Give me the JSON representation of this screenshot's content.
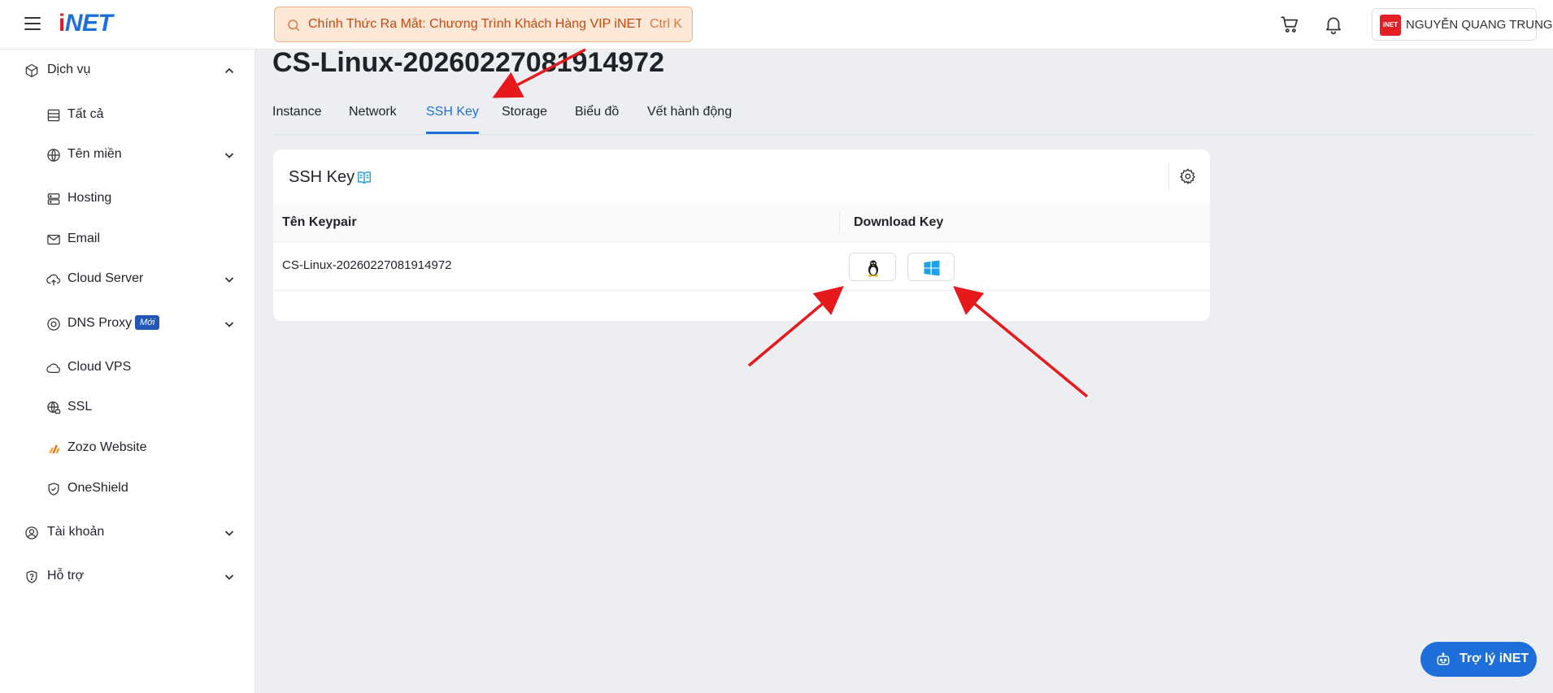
{
  "header": {
    "logo_part1": "i",
    "logo_part2": "NET",
    "search_text": "Chính Thức Ra Mắt: Chương Trình Khách Hàng VIP iNET",
    "search_shortcut": "Ctrl K",
    "user_avatar_text": "iNET",
    "user_name": "NGUYỄN QUANG TRUNG",
    "accent_color": "#1e6fd9"
  },
  "sidebar": {
    "items": [
      {
        "label": "Dịch vụ",
        "icon": "box-icon"
      },
      {
        "label": "Tất cả",
        "icon": "list-icon"
      },
      {
        "label": "Tên miền",
        "icon": "globe-icon"
      },
      {
        "label": "Hosting",
        "icon": "server-icon"
      },
      {
        "label": "Email",
        "icon": "mail-icon"
      },
      {
        "label": "Cloud Server",
        "icon": "cloud-upload-icon"
      },
      {
        "label": "DNS Proxy",
        "icon": "dns-icon",
        "badge": "Mới"
      },
      {
        "label": "Cloud VPS",
        "icon": "cloud-icon"
      },
      {
        "label": "SSL",
        "icon": "globe-lock-icon"
      },
      {
        "label": "Zozo Website",
        "icon": "zozo-icon"
      },
      {
        "label": "OneShield",
        "icon": "shield-icon"
      },
      {
        "label": "Tài khoản",
        "icon": "user-circle-icon"
      },
      {
        "label": "Hỗ trợ",
        "icon": "help-shield-icon"
      }
    ]
  },
  "main": {
    "title": "CS-Linux-20260227081914972",
    "tabs": [
      {
        "label": "Instance"
      },
      {
        "label": "Network"
      },
      {
        "label": "SSH Key",
        "active": true
      },
      {
        "label": "Storage"
      },
      {
        "label": "Biểu đồ"
      },
      {
        "label": "Vết hành động"
      }
    ],
    "card": {
      "title": "SSH Key",
      "columns": [
        "Tên Keypair",
        "Download Key"
      ],
      "rows": [
        {
          "name": "CS-Linux-20260227081914972"
        }
      ]
    }
  },
  "assistant": {
    "label": "Trợ lý iNET"
  }
}
